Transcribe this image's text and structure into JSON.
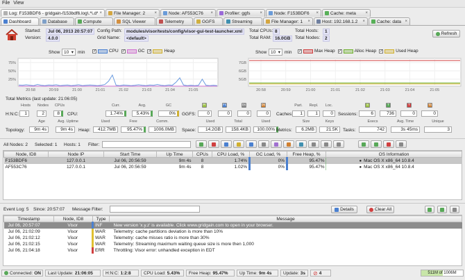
{
  "menu": {
    "file": "File",
    "view": "View"
  },
  "top_tabs": [
    {
      "label": "Log: F153BDF6 - gridgain-f153bdf6.log\\.*\\.d*",
      "color": "#b0b0b0"
    },
    {
      "label": "File Manager: 2",
      "color": "#d4a640"
    },
    {
      "label": "Node: AF553C76",
      "color": "#6a9bd8"
    },
    {
      "label": "Profiler: ggfs",
      "color": "#9a6ad8"
    },
    {
      "label": "Node: F153BDF6",
      "color": "#6a9bd8"
    },
    {
      "label": "Cache: meta",
      "color": "#58b058"
    }
  ],
  "sub_tabs": [
    {
      "label": "Dashboard",
      "color": "#4a80d0"
    },
    {
      "label": "Database",
      "color": "#7fa0c8"
    },
    {
      "label": "Compute",
      "color": "#58a858"
    },
    {
      "label": "SQL Viewer",
      "color": "#d49040"
    },
    {
      "label": "Telemetry",
      "color": "#c05050"
    },
    {
      "label": "GGFS",
      "color": "#d0b040"
    },
    {
      "label": "Streaming",
      "color": "#4090b0"
    },
    {
      "label": "File Manager: 1",
      "color": "#d4a640"
    },
    {
      "label": "Host: 192.168.1.2",
      "color": "#7080a0"
    },
    {
      "label": "Cache: data",
      "color": "#58b058"
    }
  ],
  "info": {
    "started_label": "Started:",
    "started": "Jul 06, 2013 20:57:07",
    "version_label": "Version:",
    "version": "4.0.0",
    "config_label": "Config Path:",
    "config": "modules/visor/tests/config/visor-gui-test-launcher.xml",
    "grid_label": "Grid Name:",
    "grid": "<default>",
    "cpus_label": "Total CPUs:",
    "cpus": "8",
    "ram_label": "Total RAM:",
    "ram": "16.0GB",
    "hosts_label": "Total Hosts:",
    "hosts": "1",
    "nodes_label": "Total Nodes:",
    "nodes": "2",
    "refresh": "Refresh"
  },
  "chart_cpu": {
    "show_label": "Show",
    "window": "10",
    "unit": "min",
    "legend": [
      {
        "label": "CPU",
        "color": "#4a80d0"
      },
      {
        "label": "GC",
        "color": "#d070d0"
      },
      {
        "label": "Heap",
        "color": "#d0b030"
      }
    ],
    "yticks": [
      "75%",
      "50%",
      "25%"
    ],
    "xticks": [
      "20:58",
      "20:59",
      "21:00",
      "21:01",
      "21:02",
      "21:03",
      "21:04",
      "21:05"
    ]
  },
  "chart_heap": {
    "show_label": "Show",
    "window": "10",
    "unit": "min",
    "legend": [
      {
        "label": "Max Heap",
        "color": "#d04040"
      },
      {
        "label": "Alloc Heap",
        "color": "#70b030"
      },
      {
        "label": "Used Heap",
        "color": "#d0b030"
      }
    ],
    "yticks": [
      "7GB",
      "6GB",
      "5GB"
    ],
    "xticks": [
      "20:58",
      "20:59",
      "21:00",
      "21:01",
      "21:02",
      "21:03",
      "21:04",
      "21:05"
    ]
  },
  "chart_data": [
    {
      "type": "line",
      "title": "",
      "xlabel": "",
      "ylabel": "",
      "x": [
        "20:58",
        "20:59",
        "21:00",
        "21:01",
        "21:02",
        "21:03",
        "21:04",
        "21:05"
      ],
      "ylim": [
        0,
        100
      ],
      "series": [
        {
          "name": "CPU",
          "values": [
            4,
            3,
            5,
            3,
            2,
            6,
            3,
            2,
            4,
            3,
            5,
            2,
            3,
            4,
            2,
            3,
            5,
            2,
            3,
            4,
            3,
            2,
            3,
            6,
            18,
            40,
            3,
            2,
            4,
            3,
            2,
            3,
            5,
            3,
            2,
            4,
            3,
            6,
            3,
            2,
            4,
            3,
            14,
            30,
            4,
            2,
            3,
            2,
            3,
            25,
            3,
            2,
            3,
            2
          ]
        },
        {
          "name": "GC",
          "values": [
            0,
            0,
            0,
            0,
            0,
            0,
            0,
            0,
            0,
            0,
            0,
            0,
            0,
            0,
            0,
            0,
            0,
            0,
            0,
            0,
            0,
            0,
            0,
            0,
            0,
            0,
            0,
            0,
            0,
            0,
            0,
            0,
            0,
            0,
            0,
            0,
            0,
            0,
            0,
            0,
            0,
            0,
            0,
            0,
            0,
            0,
            0,
            0,
            0,
            0,
            0,
            0,
            0,
            0
          ]
        }
      ]
    },
    {
      "type": "line",
      "title": "",
      "xlabel": "",
      "ylabel": "",
      "x": [
        "20:58",
        "20:59",
        "21:00",
        "21:01",
        "21:02",
        "21:03",
        "21:04",
        "21:05"
      ],
      "ylim": [
        4.7,
        7.3
      ],
      "series": [
        {
          "name": "Max Heap",
          "values": [
            7.1,
            7.1,
            7.1,
            7.1,
            7.1,
            7.1,
            7.1,
            7.1
          ]
        },
        {
          "name": "Alloc Heap",
          "values": [
            5.0,
            5.0,
            5.0,
            5.0,
            5.0,
            5.0,
            5.0,
            5.0
          ]
        },
        {
          "name": "Used Heap",
          "values": [
            4.9,
            4.9,
            4.9,
            4.9,
            4.9,
            4.9,
            4.9,
            4.9
          ]
        }
      ]
    }
  ],
  "metrics": {
    "title": "Total Metrics (last update: 21:06:05)",
    "h_label": "H:N:C:",
    "h_hdr": [
      "Hosts",
      "Nodes",
      "CPUs"
    ],
    "h_vals": [
      "1",
      "2",
      "8"
    ],
    "cpu_label": "CPU:",
    "cpu_hdr": [
      "Curr.",
      "Avg.",
      "GC"
    ],
    "cpu_vals": [
      "1.74%",
      "5.43%",
      "0%"
    ],
    "ggfs_label": "GGFS:",
    "ggfs_hdr": [
      "Pr",
      "Fs",
      "Ds",
      "Ds"
    ],
    "ggfs_vals": [
      "0",
      "0",
      "0",
      "0"
    ],
    "caches_label": "Caches:",
    "caches_hdr": [
      "Part.",
      "Repl.",
      "Loc."
    ],
    "caches_vals": [
      "1",
      "1",
      "0"
    ],
    "sessions_label": "Sessions:",
    "sessions_hdr": [
      "S",
      "T",
      "T",
      "Ta"
    ],
    "sessions_vals": [
      "6",
      "736",
      "0",
      "0"
    ],
    "age_hdr": [
      "Age",
      "Avg. Uptime"
    ],
    "topology_label": "Topology:",
    "topology_vals": [
      "9m 4s",
      "9m 4s"
    ],
    "heap_label": "Heap:",
    "heap_hdr": [
      "Used",
      "Free",
      "Comm."
    ],
    "heap_vals": [
      "412.7MB",
      "95.47%",
      "1006.0MB"
    ],
    "space_label": "Space:",
    "space_hdr": [
      "Used",
      "Total",
      "Used"
    ],
    "space_vals": [
      "14.2GB",
      "158.4KB",
      "100.00%"
    ],
    "metrics_label": "Metrics:",
    "metrics_hdr": [
      "Size",
      "Keys"
    ],
    "metrics_vals": [
      "6.2MB",
      "21.5K"
    ],
    "tasks_label": "Tasks:",
    "tasks_hdr": [
      "Execs",
      "Avg. Time",
      "Unique"
    ],
    "tasks_vals": [
      "742",
      "3s 45ms",
      "3"
    ]
  },
  "nodes_bar": {
    "all": "All Nodes: 2",
    "selected": "Selected: 1",
    "hosts": "Hosts: 1",
    "filter_label": "Filter:"
  },
  "nodes_table": {
    "headers": [
      "Node, ID8",
      "Node IP",
      "Start Time",
      "Up Time",
      "CPUs",
      "CPU Load, %",
      "GC Load, %",
      "Free Heap, %",
      "OS Information"
    ],
    "rows": [
      {
        "id": "F153BDF6",
        "ip": "127.0.0.1",
        "start": "Jul 06, 20:56:59",
        "up": "9m 4s",
        "cpus": "8",
        "cpu": "1.74%",
        "gc": "0%",
        "heap": "95.47%",
        "os": "Mac OS X x86_64 10.8.4",
        "cpu_frac": 0.0174,
        "heap_frac": 0.9547,
        "selected": true
      },
      {
        "id": "AF553C76",
        "ip": "127.0.0.1",
        "start": "Jul 06, 20:56:59",
        "up": "9m 4s",
        "cpus": "8",
        "cpu": "1.02%",
        "gc": "0%",
        "heap": "95.47%",
        "os": "Mac OS X x86_64 10.8.4",
        "cpu_frac": 0.0102,
        "heap_frac": 0.9547,
        "selected": false
      }
    ]
  },
  "events_bar": {
    "log": "Event Log: 5",
    "since": "Since: 20:57:07",
    "filter_label": "Message Filter:",
    "details": "Details",
    "clear": "Clear All"
  },
  "events_table": {
    "headers": [
      "Timestamp",
      "Node, ID8",
      "Type",
      "Message"
    ],
    "rows": [
      {
        "ts": "Jul 06, 20:57:07",
        "node": "Visor",
        "type": "INF",
        "msg": "New version 'x.y.z' is available. Click www.gridgain.com to open in your browser.",
        "color": "#4a80d0",
        "selected": true
      },
      {
        "ts": "Jul 06, 21:02:09",
        "node": "Visor",
        "type": "WAR",
        "msg": "Telemetry: cache partitions deviation is more than 10%",
        "color": "#e0c030",
        "selected": false
      },
      {
        "ts": "Jul 06, 21:02:12",
        "node": "Visor",
        "type": "WAR",
        "msg": "Telemetry: cache misses ratio is more than 30%",
        "color": "#e0c030",
        "selected": false
      },
      {
        "ts": "Jul 06, 21:02:15",
        "node": "Visor",
        "type": "WAR",
        "msg": "Telemetry: Streaming maximum waiting queue size is more then 1,000",
        "color": "#e0c030",
        "selected": false
      },
      {
        "ts": "Jul 06, 21:04:18",
        "node": "Visor",
        "type": "ERR",
        "msg": "Throttling: Visor error: unhandled exception in EDT",
        "color": "#d04040",
        "selected": false
      }
    ]
  },
  "status": {
    "connected_label": "Connected:",
    "connected": "ON",
    "last_label": "Last Update:",
    "last": "21:06:05",
    "hnc_label": "H:N:C:",
    "hnc": "1:2:8",
    "cpu_label": "CPU Load:",
    "cpu": "5.43%",
    "heap_label": "Free Heap:",
    "heap": "95.47%",
    "up_label": "Up Time:",
    "up": "9m 4s",
    "update_label": "Update:",
    "update": "3s",
    "errors": "4",
    "mem": "511M of 1006M",
    "mem_frac": 0.51
  }
}
